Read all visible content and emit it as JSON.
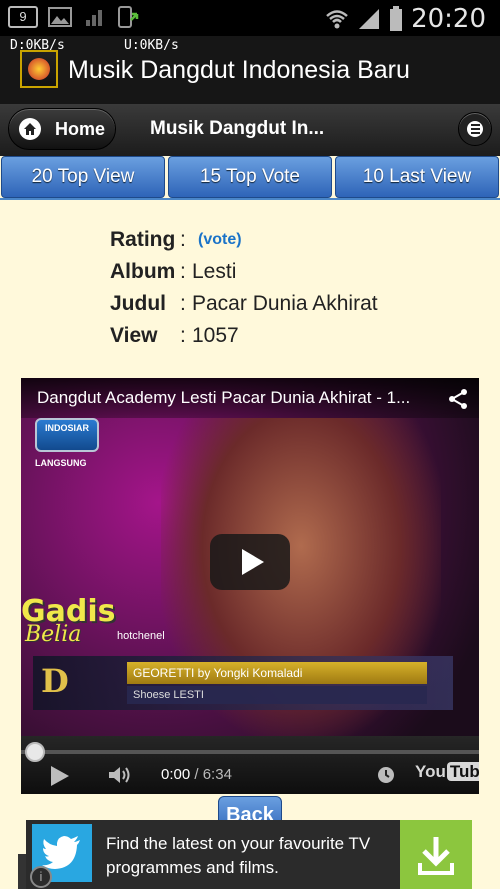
{
  "status_bar": {
    "notification_count": "9",
    "time": "20:20"
  },
  "action_bar": {
    "download_speed": "D:0KB/s",
    "upload_speed": "U:0KB/s",
    "app_title": "Musik Dangdut Indonesia Baru"
  },
  "nav": {
    "home_label": "Home",
    "title": "Musik Dangdut In..."
  },
  "tabs": [
    {
      "label": "20 Top View"
    },
    {
      "label": "15 Top Vote"
    },
    {
      "label": "10 Last View"
    }
  ],
  "info": {
    "rating_label": "Rating",
    "rating_sep": ":",
    "vote_link": "(vote)",
    "album_label": "Album",
    "album_sep": ":",
    "album_value": "Lesti",
    "judul_label": "Judul",
    "judul_sep": ":",
    "judul_value": "Pacar Dunia Akhirat",
    "view_label": "View",
    "view_sep": ":",
    "view_value": "1057"
  },
  "video": {
    "title": "Dangdut Academy Lesti Pacar Dunia Akhirat - 1...",
    "channel_logo_text": "INDOSIAR",
    "live_text": "LANGSUNG",
    "overlay_line1": "Gadis",
    "overlay_line2": "Belia",
    "overlay_small": "hotchenel",
    "lower_third_main": "GEORETTI by Yongki Komaladi",
    "lower_third_sub": "Shoese LESTI",
    "academy_logo": "D",
    "current_time": "0:00",
    "time_sep": " / ",
    "duration": "6:34",
    "youtube_prefix": "You",
    "youtube_suffix": "Tube",
    "progress_fraction": 0
  },
  "back_button": "Back",
  "ad": {
    "text": "Find the latest on your favourite TV programmes and films.",
    "info_icon": "i"
  }
}
